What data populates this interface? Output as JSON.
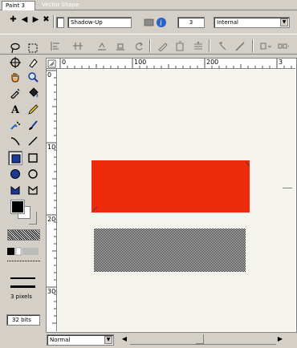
{
  "tabs": [
    {
      "label": "Paint 3",
      "active": true
    },
    {
      "label": "Vector Shape",
      "active": false
    }
  ],
  "toolbar1": {
    "nav_icons": [
      "plus-icon",
      "left-arrow-icon",
      "right-arrow-icon",
      "close-icon"
    ],
    "effect_name": "Shadow-Up",
    "effect_value": "3",
    "blend_select": "Internal"
  },
  "ruler": {
    "h_labels": [
      "0",
      "100",
      "200",
      "3"
    ],
    "v_labels": [
      "0",
      "100",
      "200",
      "300"
    ]
  },
  "toolbox": {
    "pen_width_label": "3 pixels",
    "color_depth_label": "32 bits"
  },
  "canvas": {
    "shapes": [
      {
        "name": "red-rectangle",
        "fill": "#ee2a0c"
      },
      {
        "name": "dithered-rectangle",
        "fill": "dither-pattern"
      }
    ]
  },
  "status": {
    "mode_select": "Normal"
  },
  "colors": {
    "chrome": "#d4d0c8",
    "canvas_bg": "#f5f5ed",
    "shape_red": "#ee2a0c",
    "foreground": "#000000",
    "background": "#ffffff"
  }
}
